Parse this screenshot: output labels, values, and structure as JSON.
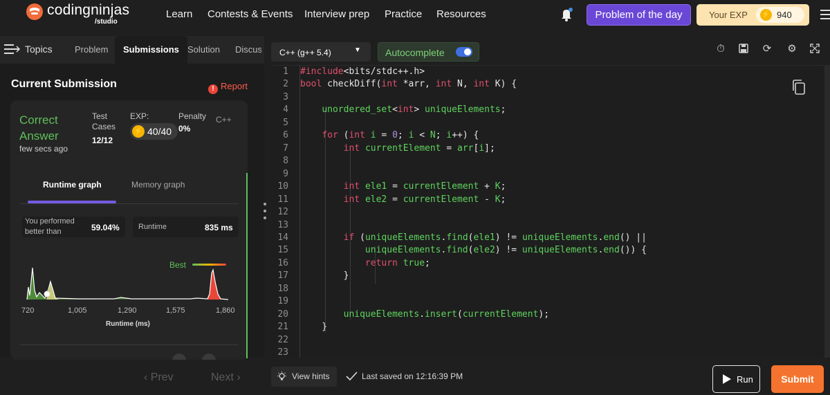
{
  "header": {
    "logo_text": "codingninjas",
    "logo_sub": "/studio",
    "nav": [
      "Learn",
      "Contests & Events",
      "Interview prep",
      "Practice",
      "Resources"
    ],
    "potd_label": "Problem of the day",
    "exp_label": "Your EXP",
    "exp_value": "940"
  },
  "tabs": {
    "topics": "Topics",
    "items": [
      "Problem",
      "Submissions",
      "Solution",
      "Discus"
    ]
  },
  "submission": {
    "title": "Current Submission",
    "report": "Report",
    "verdict": "Correct Answer",
    "time_ago": "few secs ago",
    "test_cases_label": "Test Cases",
    "test_cases_value": "12/12",
    "exp_label": "EXP:",
    "exp_value": "40/40",
    "penalty_label": "Penalty",
    "penalty_value": "0%",
    "language": "C++",
    "graph_tabs": [
      "Runtime graph",
      "Memory graph"
    ],
    "performed_label": "You performed better than",
    "performed_value": "59.04%",
    "runtime_label": "Runtime",
    "runtime_value": "835 ms",
    "best_label": "Best"
  },
  "chart_data": {
    "type": "area",
    "xlabel": "Runtime (ms)",
    "x_ticks": [
      "720",
      "1,005",
      "1,290",
      "1,575",
      "1,860"
    ],
    "xlim": [
      720,
      1860
    ],
    "highlight_x": 835,
    "legend": "Best"
  },
  "pagination": {
    "prev": "Prev",
    "next": "Next"
  },
  "editor": {
    "language": "C++ (g++ 5.4)",
    "autocomplete": "Autocomplete",
    "autocomplete_on": true
  },
  "footer": {
    "hints": "View hints",
    "saved": "Last saved on 12:16:39 PM",
    "run": "Run",
    "submit": "Submit"
  },
  "colors": {
    "accent_purple": "#6a47d6",
    "success_green": "#5fbf5a",
    "submit_orange": "#f4742f",
    "danger_red": "#e9463a"
  }
}
